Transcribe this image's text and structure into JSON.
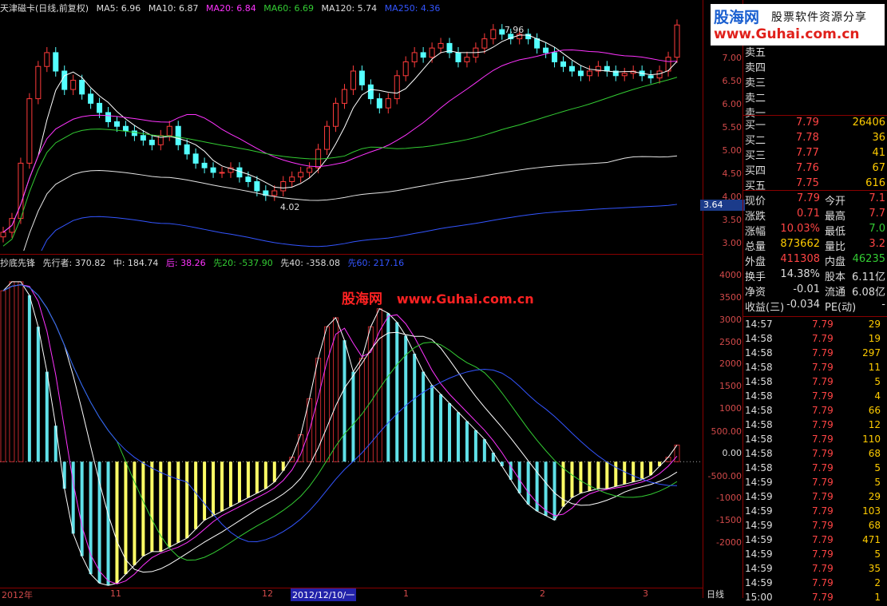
{
  "top_legend": {
    "title": "天津磁卡(日线,前复权)",
    "ma5": "MA5: 6.96",
    "ma10": "MA10: 6.87",
    "ma20": "MA20: 6.84",
    "ma60": "MA60: 6.69",
    "ma120": "MA120: 5.74",
    "ma250": "MA250: 4.36"
  },
  "sub_legend": {
    "name": "抄底先锋",
    "pioneer": "先行者: 370.82",
    "mid": "中: 184.74",
    "after": "后: 38.26",
    "x20": "先20: -537.90",
    "x40": "先40: -358.08",
    "x60": "先60: 217.16"
  },
  "annotations": {
    "high": "7.96",
    "low": "4.02",
    "current_tag": "3.64"
  },
  "watermark": {
    "cn": "股海网",
    "url": "www.Guhai.com.cn"
  },
  "logo": {
    "cn": "股海网",
    "slogan": "股票软件资源分享",
    "url": "www.Guhai.com.cn"
  },
  "price_ticks": [
    "7.00",
    "6.50",
    "6.00",
    "5.50",
    "5.00",
    "4.50",
    "4.00",
    "3.50",
    "3.00"
  ],
  "osc_ticks": [
    "4000",
    "3500",
    "3000",
    "2500",
    "2000",
    "1500",
    "1000",
    "500.00",
    "0.00",
    "-500.00",
    "-1000",
    "-1500",
    "-2000"
  ],
  "axis_dates": [
    "2012年",
    "11",
    "12",
    "2012/12/10/一",
    "1",
    "2",
    "3"
  ],
  "period_label": "日线",
  "asks": [
    {
      "k": "卖五",
      "p": "",
      "v": ""
    },
    {
      "k": "卖四",
      "p": "",
      "v": ""
    },
    {
      "k": "卖三",
      "p": "",
      "v": ""
    },
    {
      "k": "卖二",
      "p": "",
      "v": ""
    },
    {
      "k": "卖一",
      "p": "",
      "v": ""
    }
  ],
  "bids": [
    {
      "k": "买一",
      "p": "7.79",
      "v": "26406"
    },
    {
      "k": "买二",
      "p": "7.78",
      "v": "36"
    },
    {
      "k": "买三",
      "p": "7.77",
      "v": "41"
    },
    {
      "k": "买四",
      "p": "7.76",
      "v": "67"
    },
    {
      "k": "买五",
      "p": "7.75",
      "v": "616"
    }
  ],
  "quote": [
    {
      "k1": "现价",
      "v1": "7.79",
      "k2": "今开",
      "v2": "7.1"
    },
    {
      "k1": "涨跌",
      "v1": "0.71",
      "k2": "最高",
      "v2": "7.7"
    },
    {
      "k1": "涨幅",
      "v1": "10.03%",
      "k2": "最低",
      "v2": "7.0"
    },
    {
      "k1": "总量",
      "v1": "873662",
      "k2": "量比",
      "v2": "3.2"
    },
    {
      "k1": "外盘",
      "v1": "411308",
      "k2": "内盘",
      "v2": "46235"
    },
    {
      "k1": "换手",
      "v1": "14.38%",
      "k2": "股本",
      "v2": "6.11亿"
    },
    {
      "k1": "净资",
      "v1": "-0.01",
      "k2": "流通",
      "v2": "6.08亿"
    },
    {
      "k1": "收益(三)",
      "v1": "-0.034",
      "k2": "PE(动)",
      "v2": "-"
    }
  ],
  "trades": [
    {
      "t": "14:57",
      "p": "7.79",
      "v": "29"
    },
    {
      "t": "14:58",
      "p": "7.79",
      "v": "19"
    },
    {
      "t": "14:58",
      "p": "7.79",
      "v": "297"
    },
    {
      "t": "14:58",
      "p": "7.79",
      "v": "11"
    },
    {
      "t": "14:58",
      "p": "7.79",
      "v": "5"
    },
    {
      "t": "14:58",
      "p": "7.79",
      "v": "4"
    },
    {
      "t": "14:58",
      "p": "7.79",
      "v": "66"
    },
    {
      "t": "14:58",
      "p": "7.79",
      "v": "12"
    },
    {
      "t": "14:58",
      "p": "7.79",
      "v": "110"
    },
    {
      "t": "14:58",
      "p": "7.79",
      "v": "68"
    },
    {
      "t": "14:58",
      "p": "7.79",
      "v": "5"
    },
    {
      "t": "14:59",
      "p": "7.79",
      "v": "5"
    },
    {
      "t": "14:59",
      "p": "7.79",
      "v": "29"
    },
    {
      "t": "14:59",
      "p": "7.79",
      "v": "103"
    },
    {
      "t": "14:59",
      "p": "7.79",
      "v": "68"
    },
    {
      "t": "14:59",
      "p": "7.79",
      "v": "471"
    },
    {
      "t": "14:59",
      "p": "7.79",
      "v": "5"
    },
    {
      "t": "14:59",
      "p": "7.79",
      "v": "35"
    },
    {
      "t": "14:59",
      "p": "7.79",
      "v": "2"
    },
    {
      "t": "15:00",
      "p": "7.79",
      "v": "1"
    }
  ],
  "chart_data": {
    "type": "line",
    "title": "天津磁卡(日线,前复权)",
    "price_ylim": [
      2.9,
      8.1
    ],
    "close": [
      3.3,
      3.6,
      4.8,
      6.2,
      6.9,
      7.2,
      6.8,
      6.4,
      6.6,
      6.3,
      6.1,
      5.9,
      5.7,
      5.6,
      5.5,
      5.4,
      5.3,
      5.2,
      5.4,
      5.6,
      5.2,
      5.0,
      4.8,
      4.7,
      4.6,
      4.6,
      4.7,
      4.5,
      4.4,
      4.2,
      4.1,
      4.2,
      4.4,
      4.5,
      4.6,
      4.7,
      5.1,
      5.6,
      6.1,
      6.4,
      6.8,
      6.5,
      6.2,
      6.0,
      6.2,
      6.7,
      7.0,
      7.2,
      7.1,
      7.3,
      7.4,
      7.2,
      7.0,
      7.1,
      7.3,
      7.5,
      7.7,
      7.6,
      7.5,
      7.6,
      7.5,
      7.3,
      7.2,
      7.0,
      6.9,
      6.8,
      6.7,
      6.8,
      6.9,
      6.8,
      6.7,
      6.75,
      6.8,
      6.7,
      6.65,
      6.8,
      7.1,
      7.8
    ],
    "ma_series": [
      {
        "name": "MA5",
        "color": "#ffffff"
      },
      {
        "name": "MA20",
        "color": "#ff33ff"
      },
      {
        "name": "MA60",
        "color": "#33cc33"
      },
      {
        "name": "MA120",
        "color": "#e6e6e6"
      },
      {
        "name": "MA250",
        "color": "#3355ff"
      }
    ],
    "osc_ylim": [
      -2800,
      4300
    ],
    "osc_values": [
      3800,
      4000,
      4000,
      3700,
      3000,
      2000,
      800,
      -600,
      -1600,
      -2100,
      -2500,
      -2700,
      -2750,
      -2700,
      -2500,
      -2300,
      -2100,
      -2000,
      -2000,
      -1900,
      -1800,
      -1700,
      -1500,
      -1300,
      -1200,
      -1100,
      -1000,
      -900,
      -800,
      -700,
      -600,
      -450,
      -200,
      100,
      600,
      1400,
      2300,
      3000,
      3200,
      2700,
      2000,
      2300,
      3000,
      3400,
      3300,
      3100,
      2800,
      2400,
      2000,
      1700,
      1500,
      1300,
      1100,
      900,
      700,
      500,
      200,
      -100,
      -400,
      -700,
      -950,
      -1100,
      -1200,
      -1300,
      -1000,
      -800,
      -700,
      -650,
      -600,
      -600,
      -550,
      -500,
      -450,
      -400,
      -300,
      -100,
      100,
      370
    ]
  }
}
